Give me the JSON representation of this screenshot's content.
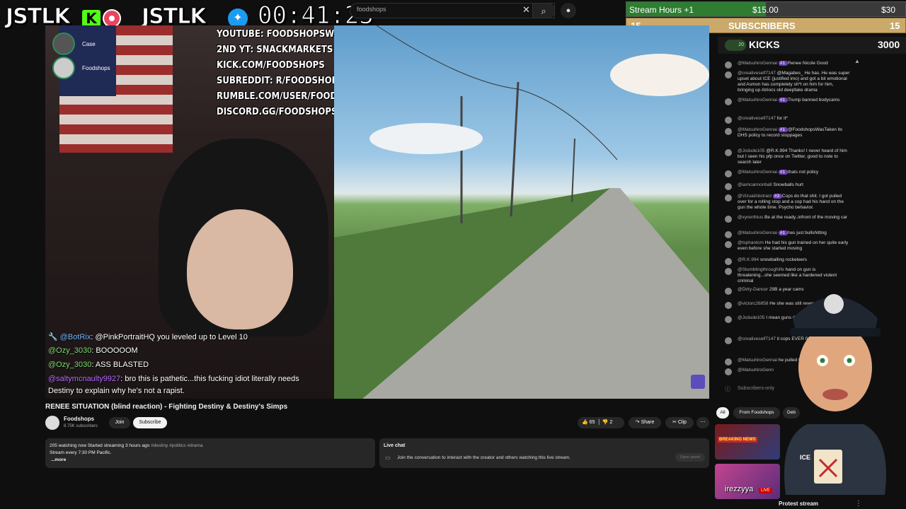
{
  "overlay": {
    "brand_left": "JSTLK",
    "kick_letter": "K",
    "brand_right": "JSTLK_",
    "timer": "00:41:23",
    "goal_label": "Stream Hours +1",
    "goal_amount": "$15.00",
    "goal_target": "$30",
    "goal_progress": 0.5,
    "subs_left": "15",
    "subs_label": "SUBSCRIBERS",
    "subs_right": "15",
    "kicks_count_badge": "0",
    "kicks_label": "KICKS",
    "kicks_value": "3000",
    "kick_avatar_count": "20"
  },
  "search": {
    "query": "foodshops"
  },
  "stream": {
    "socials": [
      "YOUTUBE: FOODSHOPSWASTAKEN",
      "2ND YT: SNACKMARKETS",
      "KICK.COM/FOODSHOPS",
      "SUBREDDIT: R/FOODSHOPS",
      "RUMBLE.COM/USER/FOODSHOPS",
      "DISCORD.GG/FOODSHOPS"
    ],
    "cam_users": [
      {
        "name": "Case"
      },
      {
        "name": "Foodshops"
      }
    ],
    "chat": [
      {
        "user": "@BotRix",
        "text": ": @PinkPortraitHQ you leveled up to Level 10",
        "color": "#6fb6ff"
      },
      {
        "user": "@Ozy_3030",
        "text": ": BOOOOOM",
        "color": "#7ddc6f"
      },
      {
        "user": "@Ozy_3030",
        "text": ": ASS BLASTED",
        "color": "#7ddc6f"
      },
      {
        "user": "@saltymcnaulty9927",
        "text": ": bro this is pathetic...this fucking idiot literally needs",
        "color": "#b56cff"
      },
      {
        "user": "",
        "text": "Destiny to explain why he's not a rapist.",
        "color": "#ffffff"
      }
    ]
  },
  "video": {
    "title": "RENEE SITUATION (blind reaction) - Fighting Destiny & Destiny's Simps",
    "channel": "Foodshops",
    "subscribers": "8.75K subscribers",
    "join_label": "Join",
    "subscribe_label": "Subscribe",
    "likes": "65",
    "dislikes": "2",
    "share_label": "Share",
    "clip_label": "Clip",
    "description_stats": "205 watching now  Started streaming 3 hours ago",
    "description_tags": "#destiny #politics #drama",
    "description_line2": "Stream every 7:30 PM Pacific.",
    "description_more": "...more"
  },
  "livechat": {
    "title": "Live chat",
    "prompt": "Join the conversation to interact with the creator and others watching this live stream.",
    "open_panel": "Open panel"
  },
  "side_chat": {
    "messages": [
      {
        "user": "@MatsuhiroGennai",
        "badge": "#1",
        "text": "Renee Nicole Good"
      },
      {
        "user": "@creativeself7147",
        "badge": "",
        "text": "@Magabes_ He has. He was super upset about ICE (justified imo) and got a bit emotional and Asmon has completely sh*t on him for him, bringing up Atriocs old deepfake drama"
      },
      {
        "user": "@MatsuhiroGennai",
        "badge": "#1",
        "text": "Trump banned bodycams"
      },
      {
        "user": "@creativeself7147",
        "badge": "",
        "text": "for it*"
      },
      {
        "user": "@MatsuhiroGennai",
        "badge": "#1",
        "text": "@FoodshopsWasTaken its DHS policy to record stoppages"
      },
      {
        "user": "@Jcdude105",
        "badge": "",
        "text": "@R.K.994 Thanks! I never heard of him but I seen his pfp once on Twitter, good to note to search later"
      },
      {
        "user": "@MatsuhiroGennai",
        "badge": "#1",
        "text": "thats not policy"
      },
      {
        "user": "@iamcannonball",
        "badge": "",
        "text": "Snowballs hurt"
      },
      {
        "user": "@VizualAbstract",
        "badge": "#3",
        "text": "Cops do that shit. I got pulled over for a rolling stop and a cop had his hand on the gun the whole time. Psycho behavior."
      },
      {
        "user": "@xyrenthius",
        "badge": "",
        "text": "Be at the ready..infront of the moving car"
      },
      {
        "user": "@MatsuhiroGennai",
        "badge": "#1",
        "text": "hes just bullshitting"
      },
      {
        "user": "@tsphantom",
        "badge": "",
        "text": "He had his gun trained on her quite early even before she started moving"
      },
      {
        "user": "@R.K.994",
        "badge": "",
        "text": "snowballing rocketeers"
      },
      {
        "user": "@Stumblingthroughlife",
        "badge": "",
        "text": "hand on gun is threatening...she seemed like a hardened violent criminal"
      },
      {
        "user": "@Dirty-Dancer",
        "badge": "",
        "text": "29B a year cams"
      },
      {
        "user": "@victorc26858",
        "badge": "",
        "text": "He she was still reversing"
      },
      {
        "user": "@Jcdude105",
        "badge": "",
        "text": "I mean guns drawn after and not point"
      },
      {
        "user": "@creativeself7147",
        "badge": "",
        "text": "it cops EVER fire a SING"
      },
      {
        "user": "@MatsuhiroGennai",
        "badge": "",
        "text": "he pulled the gun"
      },
      {
        "user": "@MatsuhiroGenn",
        "badge": "",
        "text": ""
      }
    ],
    "footer": "Subscribers-only"
  },
  "recommend": {
    "tabs": [
      "All",
      "From Foodshops",
      "Deb"
    ],
    "thumb1_title": "BREAKING NEWS",
    "thumb2_label": "irezzyya",
    "live_badge": "LIVE",
    "item_title": "Protest stream"
  },
  "mascot": {
    "badge_text": "ICE"
  }
}
